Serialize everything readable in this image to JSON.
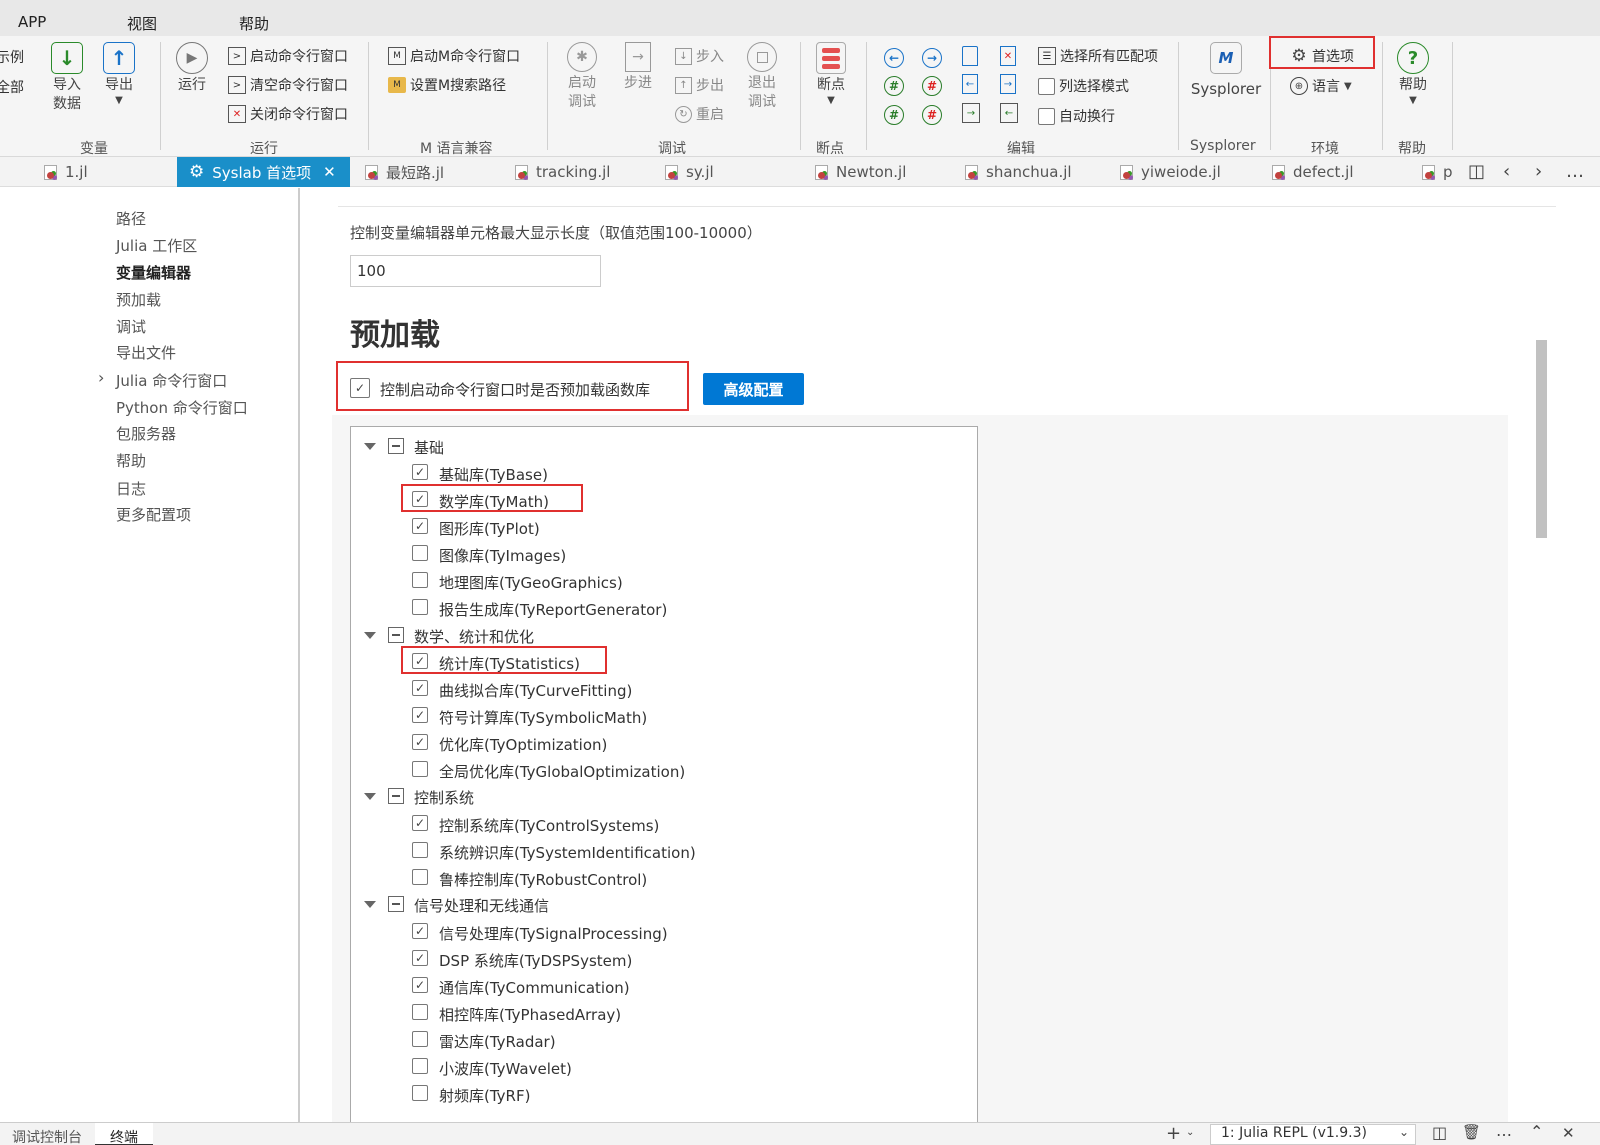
{
  "menubar": {
    "items": [
      "APP",
      "视图",
      "帮助"
    ]
  },
  "ribbon": {
    "left_cut": [
      "示例",
      "全部"
    ],
    "variables": {
      "import_label": "导入数据",
      "export_label": "导出",
      "group_label": "变量"
    },
    "run": {
      "run_label": "运行",
      "start_cmd": "启动命令行窗口",
      "clear_cmd": "清空命令行窗口",
      "close_cmd": "关闭命令行窗口",
      "group_label": "运行"
    },
    "m_compat": {
      "start_m_cmd": "启动M命令行窗口",
      "set_m_path": "设置M搜索路径",
      "group_label": "M 语言兼容"
    },
    "debug": {
      "start_label": "启动调试",
      "step_label": "步进",
      "step_in": "步入",
      "step_out": "步出",
      "restart": "重启",
      "exit_label": "退出调试",
      "group_label": "调试"
    },
    "breakpoint": {
      "label": "断点",
      "group_label": "断点"
    },
    "edit": {
      "select_all_matches": "选择所有匹配项",
      "column_select": "列选择模式",
      "word_wrap": "自动换行",
      "group_label": "编辑"
    },
    "sysplorer": {
      "label": "Sysplorer",
      "group_label": "Sysplorer"
    },
    "env": {
      "preferences": "首选项",
      "language": "语言",
      "group_label": "环境"
    },
    "help": {
      "label": "帮助",
      "group_label": "帮助"
    }
  },
  "tabs": [
    {
      "label": "1.jl",
      "active": false
    },
    {
      "label": "Syslab 首选项",
      "active": true
    },
    {
      "label": "最短路.jl",
      "active": false
    },
    {
      "label": "tracking.jl",
      "active": false
    },
    {
      "label": "sy.jl",
      "active": false
    },
    {
      "label": "Newton.jl",
      "active": false
    },
    {
      "label": "shanchua.jl",
      "active": false
    },
    {
      "label": "yiweiode.jl",
      "active": false
    },
    {
      "label": "defect.jl",
      "active": false
    },
    {
      "label": "p",
      "active": false
    }
  ],
  "nav": {
    "items": [
      "路径",
      "Julia 工作区",
      "变量编辑器",
      "预加载",
      "调试",
      "导出文件",
      "Julia 命令行窗口",
      "Python 命令行窗口",
      "包服务器",
      "帮助",
      "日志",
      "更多配置项"
    ],
    "active_index": 2
  },
  "content": {
    "cell_length_label": "控制变量编辑器单元格最大显示长度（取值范围100-10000）",
    "cell_length_value": "100",
    "preload_heading": "预加载",
    "preload_checkbox_label": "控制启动命令行窗口时是否预加载函数库",
    "preload_checked": true,
    "advanced_button": "高级配置",
    "groups": [
      {
        "name": "基础",
        "items": [
          {
            "label": "基础库(TyBase)",
            "checked": true
          },
          {
            "label": "数学库(TyMath)",
            "checked": true
          },
          {
            "label": "图形库(TyPlot)",
            "checked": true
          },
          {
            "label": "图像库(TyImages)",
            "checked": false
          },
          {
            "label": "地理图库(TyGeoGraphics)",
            "checked": false
          },
          {
            "label": "报告生成库(TyReportGenerator)",
            "checked": false
          }
        ]
      },
      {
        "name": "数学、统计和优化",
        "items": [
          {
            "label": "统计库(TyStatistics)",
            "checked": true
          },
          {
            "label": "曲线拟合库(TyCurveFitting)",
            "checked": true
          },
          {
            "label": "符号计算库(TySymbolicMath)",
            "checked": true
          },
          {
            "label": "优化库(TyOptimization)",
            "checked": true
          },
          {
            "label": "全局优化库(TyGlobalOptimization)",
            "checked": false
          }
        ]
      },
      {
        "name": "控制系统",
        "items": [
          {
            "label": "控制系统库(TyControlSystems)",
            "checked": true
          },
          {
            "label": "系统辨识库(TySystemIdentification)",
            "checked": false
          },
          {
            "label": "鲁棒控制库(TyRobustControl)",
            "checked": false
          }
        ]
      },
      {
        "name": "信号处理和无线通信",
        "items": [
          {
            "label": "信号处理库(TySignalProcessing)",
            "checked": true
          },
          {
            "label": "DSP 系统库(TyDSPSystem)",
            "checked": true
          },
          {
            "label": "通信库(TyCommunication)",
            "checked": true
          },
          {
            "label": "相控阵库(TyPhasedArray)",
            "checked": false
          },
          {
            "label": "雷达库(TyRadar)",
            "checked": false
          },
          {
            "label": "小波库(TyWavelet)",
            "checked": false
          },
          {
            "label": "射频库(TyRF)",
            "checked": false
          }
        ]
      }
    ]
  },
  "bottom": {
    "tabs": [
      "调试控制台",
      "终端"
    ],
    "active_index": 1,
    "terminal_select": "1: Julia REPL (v1.9.3)"
  },
  "colors": {
    "accent": "#1a8fc9",
    "button_blue": "#0078d4",
    "highlight_red": "#e0302f"
  }
}
